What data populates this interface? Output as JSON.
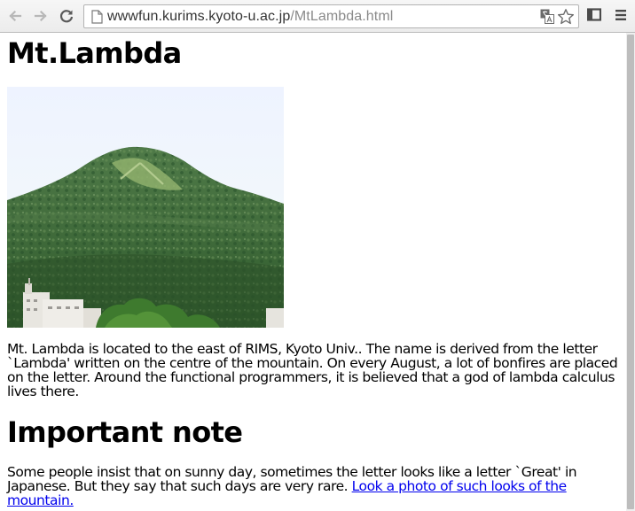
{
  "browser": {
    "url_host": "wwwfun.kurims.kyoto-u.ac.jp",
    "url_path": "/MtLambda.html",
    "icons": {
      "back": "back-arrow-icon",
      "forward": "forward-arrow-icon",
      "reload": "reload-icon",
      "page": "page-icon",
      "translate": "translate-icon",
      "bookmark": "star-icon",
      "cast": "cast-icon",
      "menu": "hamburger-menu-icon"
    }
  },
  "page": {
    "title": "Mt.Lambda",
    "intro_text": "Mt. Lambda is located to the east of RIMS, Kyoto Univ.. The name is derived from the letter `Lambda' written on the centre of the mountain. On every August, a lot of bonfires are placed on the letter. Around the functional programmers, it is believed that a god of lambda calculus lives there.",
    "note_heading": "Important note",
    "note_text": "Some people insist that on sunny day, sometimes the letter looks like a letter `Great' in Japanese. But they say that such days are very rare. ",
    "note_link": "Look a photo of such looks of the mountain."
  }
}
